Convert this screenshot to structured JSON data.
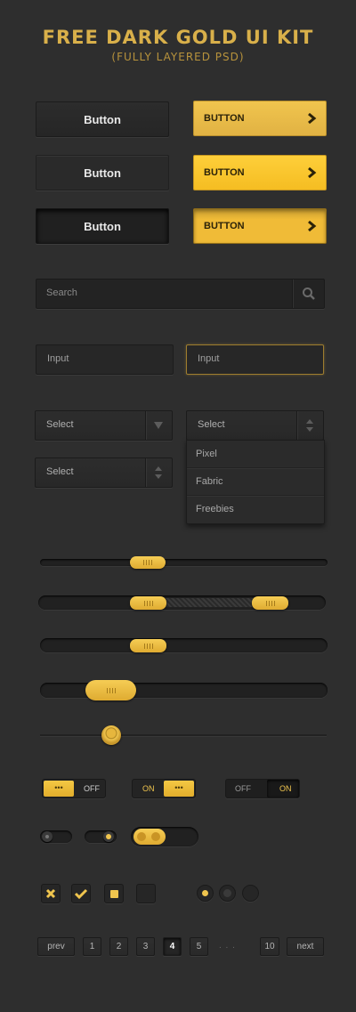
{
  "header": {
    "title": "FREE DARK GOLD UI KIT",
    "subtitle": "(FULLY LAYERED PSD)"
  },
  "colors": {
    "background": "#2e2e2e",
    "gold": "#f1c54e",
    "gold_text": "#d9b04a"
  },
  "buttons": {
    "dark": [
      "Button",
      "Button",
      "Button"
    ],
    "gold": [
      "BUTTON",
      "BUTTON",
      "BUTTON"
    ],
    "icon": "chevron-right-icon"
  },
  "search": {
    "placeholder": "Search",
    "icon": "search-icon"
  },
  "inputs": [
    {
      "placeholder": "Input",
      "state": "normal"
    },
    {
      "placeholder": "Input",
      "state": "focused"
    }
  ],
  "selects": [
    {
      "value": "Select",
      "arrow": "triangle-down"
    },
    {
      "value": "Select",
      "arrow": "up-down",
      "open": true
    },
    {
      "value": "Select",
      "arrow": "up-down"
    }
  ],
  "dropdown": {
    "options": [
      "Pixel",
      "Fabric",
      "Freebies"
    ]
  },
  "sliders": [
    {
      "type": "single",
      "value": 0.37
    },
    {
      "type": "range",
      "low": 0.37,
      "high": 0.86
    },
    {
      "type": "single",
      "value": 0.37
    },
    {
      "type": "single",
      "value": 0.24
    },
    {
      "type": "thin",
      "value": 0.25
    }
  ],
  "toggles": [
    {
      "state": "off",
      "on_label": "•••",
      "off_label": "OFF"
    },
    {
      "state": "on",
      "on_label": "ON",
      "off_label": "•••"
    },
    {
      "state": "on",
      "labels": [
        "OFF",
        "ON"
      ]
    }
  ],
  "mini_toggles": [
    {
      "state": "off"
    },
    {
      "state": "on"
    },
    {
      "state": "on"
    }
  ],
  "checkboxes": [
    {
      "state": "cross"
    },
    {
      "state": "check"
    },
    {
      "state": "square"
    },
    {
      "state": "empty"
    }
  ],
  "radios": [
    {
      "state": "selected"
    },
    {
      "state": "unselected"
    },
    {
      "state": "unselected"
    }
  ],
  "pagination": {
    "prev": "prev",
    "next": "next",
    "pages": [
      "1",
      "2",
      "3",
      "4",
      "5"
    ],
    "current": "4",
    "ellipsis": ". . .",
    "last": "10"
  }
}
